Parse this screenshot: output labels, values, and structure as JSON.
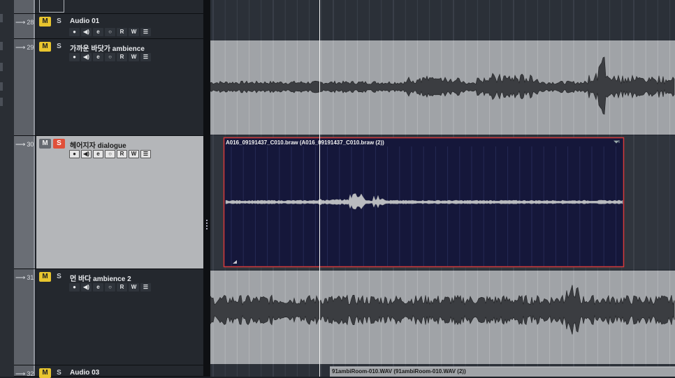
{
  "tracks": [
    {
      "number": "28",
      "name": "Audio 01",
      "mute": "M",
      "solo": "S"
    },
    {
      "number": "29",
      "name": "가까운 바닷가 ambience",
      "mute": "M",
      "solo": "S"
    },
    {
      "number": "30",
      "name": "헤어지자 dialogue",
      "mute": "M",
      "solo": "S"
    },
    {
      "number": "31",
      "name": "먼 바다 ambience 2",
      "mute": "M",
      "solo": "S"
    },
    {
      "number": "32",
      "name": "Audio 03",
      "mute": "M",
      "solo": "S"
    }
  ],
  "track_controls": {
    "record": "●",
    "monitor": "◀)",
    "edit": "e",
    "freeze": "○",
    "read": "R",
    "write": "W",
    "inserts": "☰"
  },
  "clips": {
    "dialogue_event": "A016_09191437_C010.braw (A016_09191437_C010.braw (2))",
    "ambi_event": "91ambiRoom-010.WAV (91ambiRoom-010.WAV (2))"
  },
  "colors": {
    "mute_active": "#e8c52e",
    "solo_active": "#e0503a",
    "event_border_selected": "#d63a3a",
    "event_bg_selected": "#15173a",
    "waveform_dark": "#3a3c40"
  }
}
